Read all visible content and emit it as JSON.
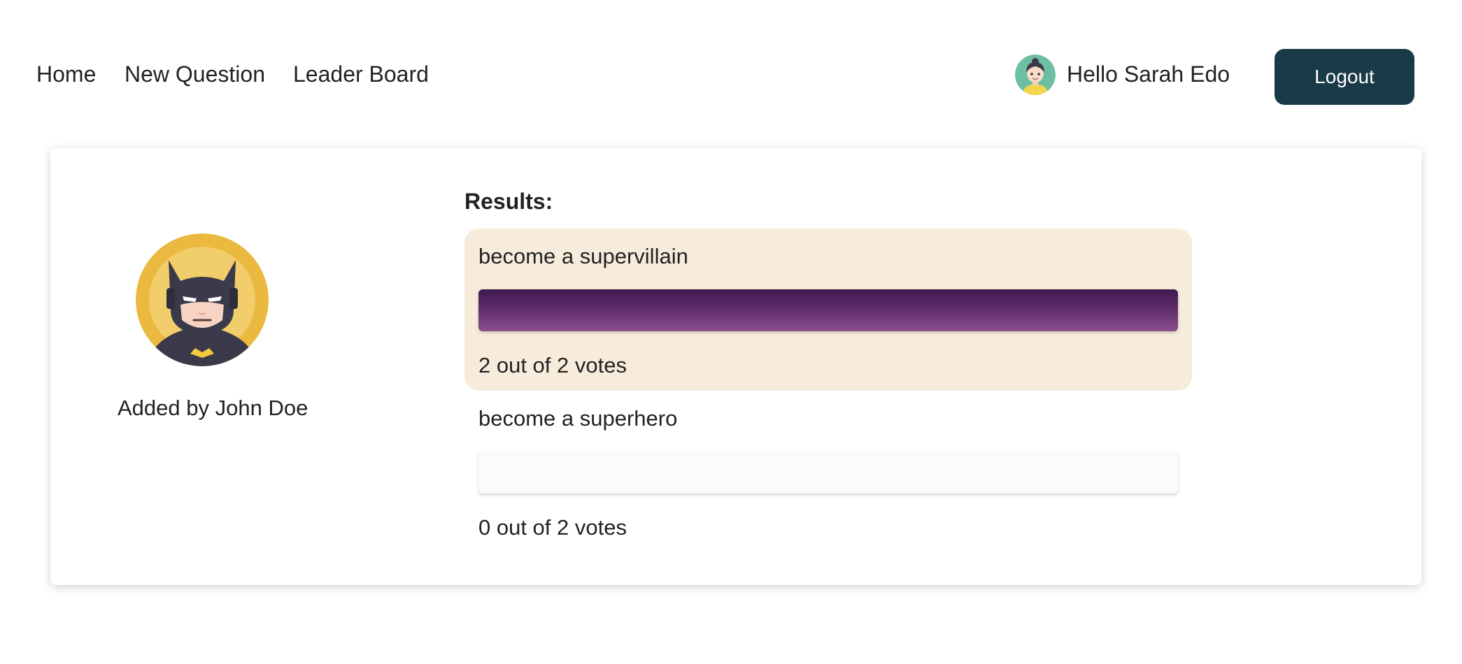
{
  "nav": {
    "links": [
      {
        "label": "Home"
      },
      {
        "label": "New Question"
      },
      {
        "label": "Leader Board"
      }
    ],
    "greeting": "Hello Sarah Edo",
    "user_avatar_icon": "girl-avatar-icon",
    "logout_label": "Logout"
  },
  "poll": {
    "author_avatar_icon": "batman-avatar-icon",
    "author_line": "Added by John Doe",
    "results_title": "Results:",
    "options": [
      {
        "text": "become a supervillain",
        "votes_text": "2 out of 2 votes",
        "votes": 2,
        "total": 2,
        "fraction": 1.0,
        "selected": true
      },
      {
        "text": "become a superhero",
        "votes_text": "0 out of 2 votes",
        "votes": 0,
        "total": 2,
        "fraction": 0.0,
        "selected": false
      }
    ]
  },
  "colors": {
    "logout_bg": "#1a3a48",
    "selected_option_bg": "#f7ebdb",
    "bar_fill_top": "#3e1a4e",
    "bar_fill_bottom": "#8a4f8d"
  }
}
